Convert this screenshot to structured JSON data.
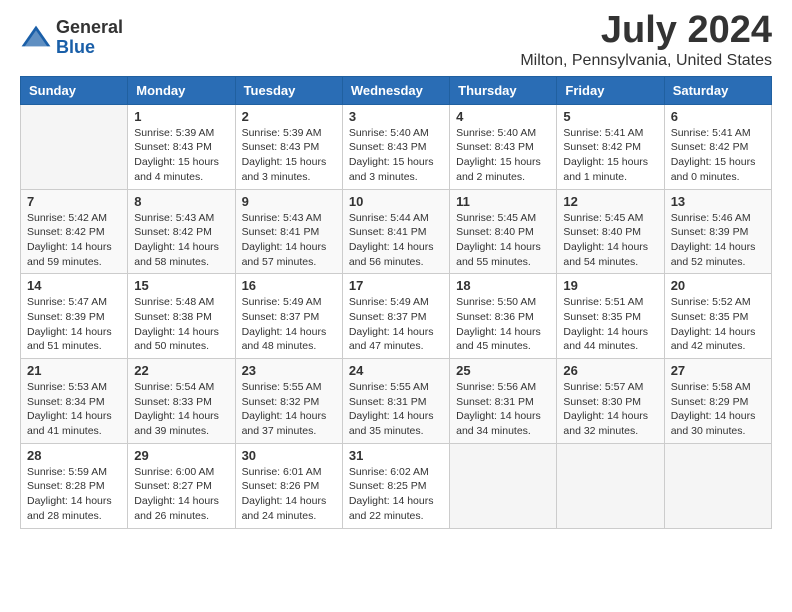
{
  "header": {
    "logo_general": "General",
    "logo_blue": "Blue",
    "title": "July 2024",
    "subtitle": "Milton, Pennsylvania, United States"
  },
  "weekdays": [
    "Sunday",
    "Monday",
    "Tuesday",
    "Wednesday",
    "Thursday",
    "Friday",
    "Saturday"
  ],
  "weeks": [
    [
      {
        "day": "",
        "info": ""
      },
      {
        "day": "1",
        "info": "Sunrise: 5:39 AM\nSunset: 8:43 PM\nDaylight: 15 hours\nand 4 minutes."
      },
      {
        "day": "2",
        "info": "Sunrise: 5:39 AM\nSunset: 8:43 PM\nDaylight: 15 hours\nand 3 minutes."
      },
      {
        "day": "3",
        "info": "Sunrise: 5:40 AM\nSunset: 8:43 PM\nDaylight: 15 hours\nand 3 minutes."
      },
      {
        "day": "4",
        "info": "Sunrise: 5:40 AM\nSunset: 8:43 PM\nDaylight: 15 hours\nand 2 minutes."
      },
      {
        "day": "5",
        "info": "Sunrise: 5:41 AM\nSunset: 8:42 PM\nDaylight: 15 hours\nand 1 minute."
      },
      {
        "day": "6",
        "info": "Sunrise: 5:41 AM\nSunset: 8:42 PM\nDaylight: 15 hours\nand 0 minutes."
      }
    ],
    [
      {
        "day": "7",
        "info": "Sunrise: 5:42 AM\nSunset: 8:42 PM\nDaylight: 14 hours\nand 59 minutes."
      },
      {
        "day": "8",
        "info": "Sunrise: 5:43 AM\nSunset: 8:42 PM\nDaylight: 14 hours\nand 58 minutes."
      },
      {
        "day": "9",
        "info": "Sunrise: 5:43 AM\nSunset: 8:41 PM\nDaylight: 14 hours\nand 57 minutes."
      },
      {
        "day": "10",
        "info": "Sunrise: 5:44 AM\nSunset: 8:41 PM\nDaylight: 14 hours\nand 56 minutes."
      },
      {
        "day": "11",
        "info": "Sunrise: 5:45 AM\nSunset: 8:40 PM\nDaylight: 14 hours\nand 55 minutes."
      },
      {
        "day": "12",
        "info": "Sunrise: 5:45 AM\nSunset: 8:40 PM\nDaylight: 14 hours\nand 54 minutes."
      },
      {
        "day": "13",
        "info": "Sunrise: 5:46 AM\nSunset: 8:39 PM\nDaylight: 14 hours\nand 52 minutes."
      }
    ],
    [
      {
        "day": "14",
        "info": "Sunrise: 5:47 AM\nSunset: 8:39 PM\nDaylight: 14 hours\nand 51 minutes."
      },
      {
        "day": "15",
        "info": "Sunrise: 5:48 AM\nSunset: 8:38 PM\nDaylight: 14 hours\nand 50 minutes."
      },
      {
        "day": "16",
        "info": "Sunrise: 5:49 AM\nSunset: 8:37 PM\nDaylight: 14 hours\nand 48 minutes."
      },
      {
        "day": "17",
        "info": "Sunrise: 5:49 AM\nSunset: 8:37 PM\nDaylight: 14 hours\nand 47 minutes."
      },
      {
        "day": "18",
        "info": "Sunrise: 5:50 AM\nSunset: 8:36 PM\nDaylight: 14 hours\nand 45 minutes."
      },
      {
        "day": "19",
        "info": "Sunrise: 5:51 AM\nSunset: 8:35 PM\nDaylight: 14 hours\nand 44 minutes."
      },
      {
        "day": "20",
        "info": "Sunrise: 5:52 AM\nSunset: 8:35 PM\nDaylight: 14 hours\nand 42 minutes."
      }
    ],
    [
      {
        "day": "21",
        "info": "Sunrise: 5:53 AM\nSunset: 8:34 PM\nDaylight: 14 hours\nand 41 minutes."
      },
      {
        "day": "22",
        "info": "Sunrise: 5:54 AM\nSunset: 8:33 PM\nDaylight: 14 hours\nand 39 minutes."
      },
      {
        "day": "23",
        "info": "Sunrise: 5:55 AM\nSunset: 8:32 PM\nDaylight: 14 hours\nand 37 minutes."
      },
      {
        "day": "24",
        "info": "Sunrise: 5:55 AM\nSunset: 8:31 PM\nDaylight: 14 hours\nand 35 minutes."
      },
      {
        "day": "25",
        "info": "Sunrise: 5:56 AM\nSunset: 8:31 PM\nDaylight: 14 hours\nand 34 minutes."
      },
      {
        "day": "26",
        "info": "Sunrise: 5:57 AM\nSunset: 8:30 PM\nDaylight: 14 hours\nand 32 minutes."
      },
      {
        "day": "27",
        "info": "Sunrise: 5:58 AM\nSunset: 8:29 PM\nDaylight: 14 hours\nand 30 minutes."
      }
    ],
    [
      {
        "day": "28",
        "info": "Sunrise: 5:59 AM\nSunset: 8:28 PM\nDaylight: 14 hours\nand 28 minutes."
      },
      {
        "day": "29",
        "info": "Sunrise: 6:00 AM\nSunset: 8:27 PM\nDaylight: 14 hours\nand 26 minutes."
      },
      {
        "day": "30",
        "info": "Sunrise: 6:01 AM\nSunset: 8:26 PM\nDaylight: 14 hours\nand 24 minutes."
      },
      {
        "day": "31",
        "info": "Sunrise: 6:02 AM\nSunset: 8:25 PM\nDaylight: 14 hours\nand 22 minutes."
      },
      {
        "day": "",
        "info": ""
      },
      {
        "day": "",
        "info": ""
      },
      {
        "day": "",
        "info": ""
      }
    ]
  ]
}
